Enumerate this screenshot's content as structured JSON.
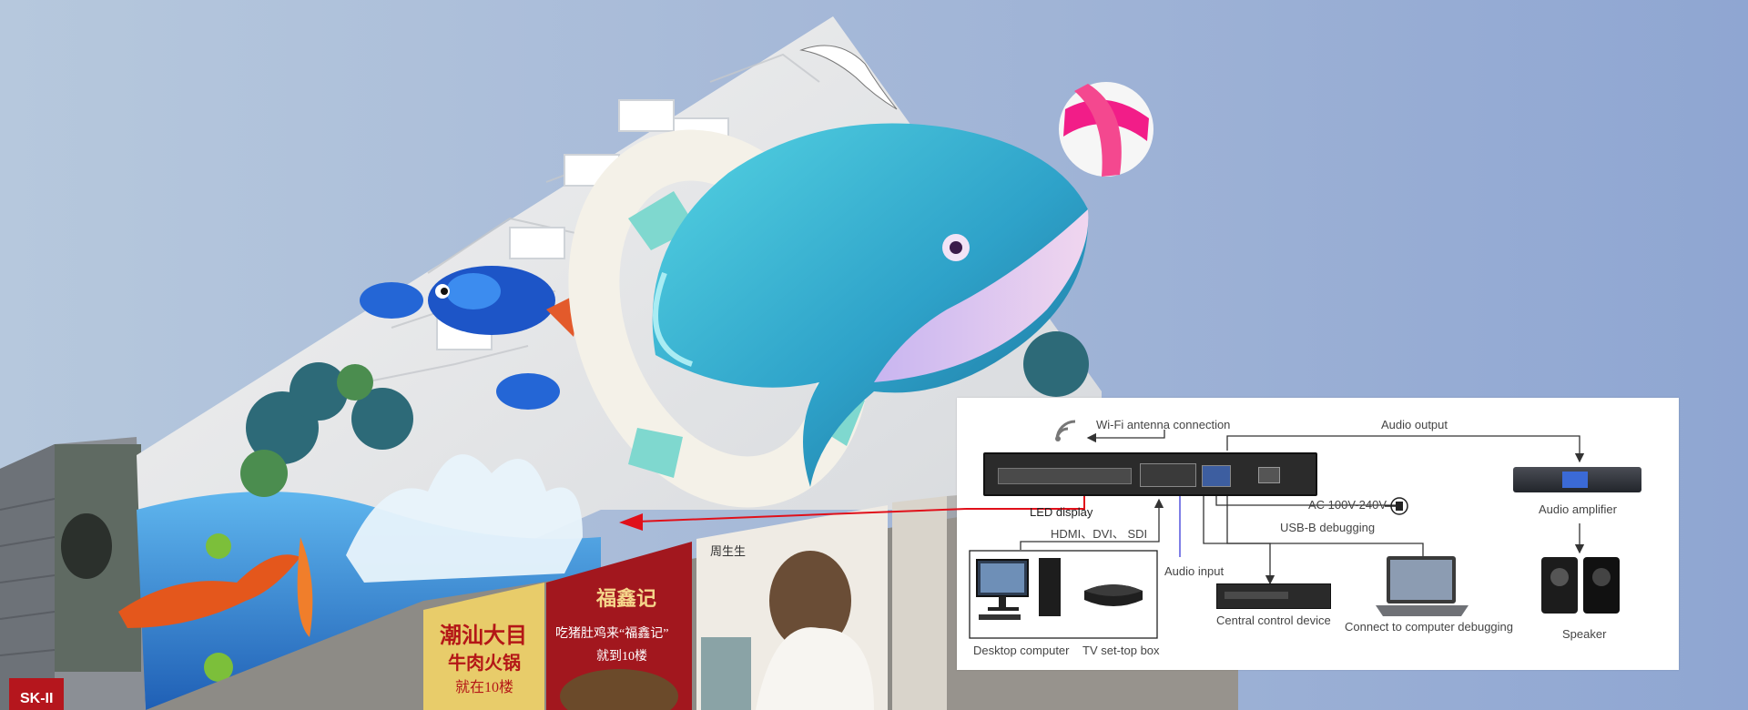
{
  "billboard": {
    "photo_signs": [
      {
        "text": "潮汕大目"
      },
      {
        "text": "牛肉火锅"
      },
      {
        "text": "就在10楼"
      },
      {
        "text": "福鑫记"
      },
      {
        "text": "吃猪肚鸡来“福鑫记”"
      },
      {
        "text": "就到10楼"
      },
      {
        "text": "周生生"
      },
      {
        "text": "SK-II"
      }
    ]
  },
  "diagram": {
    "labels": {
      "wifi": "Wi-Fi antenna connection",
      "audio_output": "Audio output",
      "led_display": "LED display",
      "ac_power": "AC 100V-240V",
      "usb_debug": "USB-B debugging",
      "hdmi_dvi_sdi": "HDMI、DVI、 SDI",
      "audio_input": "Audio input",
      "central_control": "Central control device",
      "connect_computer": "Connect to computer debugging",
      "audio_amplifier": "Audio amplifier",
      "speaker": "Speaker",
      "desktop": "Desktop computer",
      "tv_box": "TV set-top box"
    },
    "colors": {
      "arrow_red": "#e0101a",
      "audio_line": "#3a3ad8",
      "line": "#333333"
    },
    "icons": [
      "wifi-icon",
      "controller-icon",
      "power-plug-icon",
      "amplifier-icon",
      "speaker-icon",
      "desktop-computer-icon",
      "tv-box-icon",
      "central-control-icon",
      "laptop-icon"
    ]
  }
}
